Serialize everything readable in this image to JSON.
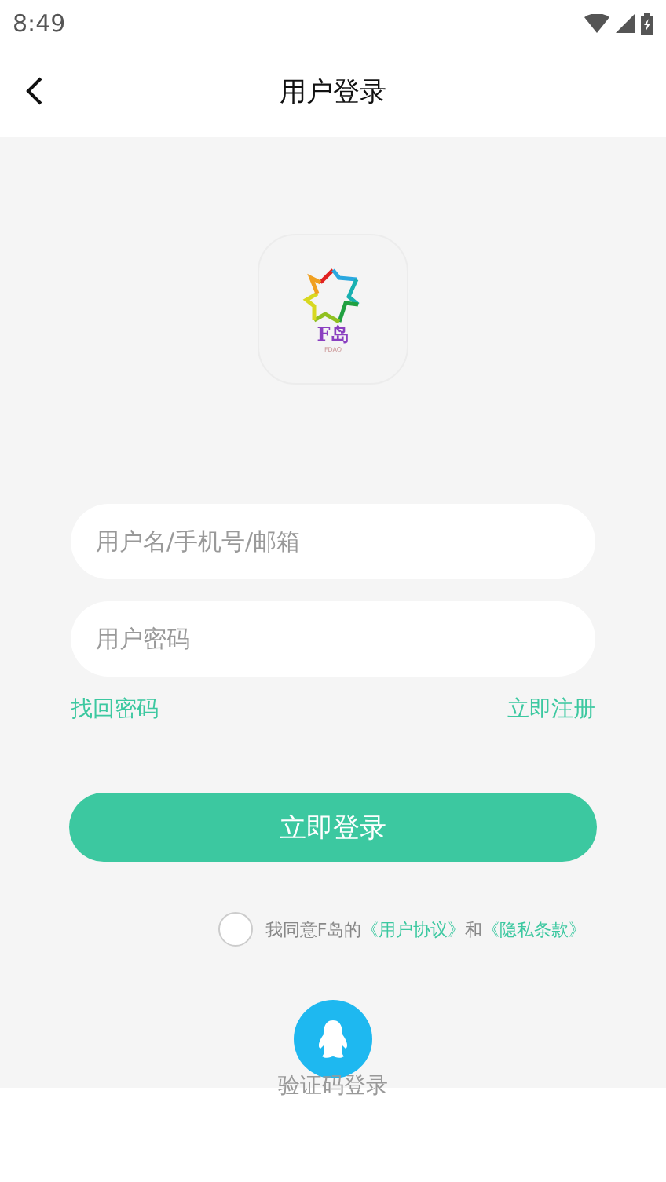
{
  "status_bar": {
    "time": "8:49"
  },
  "header": {
    "title": "用户登录"
  },
  "logo": {
    "name": "F岛",
    "subtitle": "FDAO"
  },
  "fields": [
    {
      "placeholder": "用户名/手机号/邮箱"
    },
    {
      "placeholder": "用户密码"
    }
  ],
  "links": {
    "forgot": "找回密码",
    "register": "立即注册"
  },
  "login_button": "立即登录",
  "agreement": {
    "checked": false,
    "prefix": "我同意F岛的",
    "terms": "《用户协议》",
    "joiner": "和",
    "privacy": "《隐私条款》"
  },
  "alt_login": {
    "label": "验证码登录"
  }
}
